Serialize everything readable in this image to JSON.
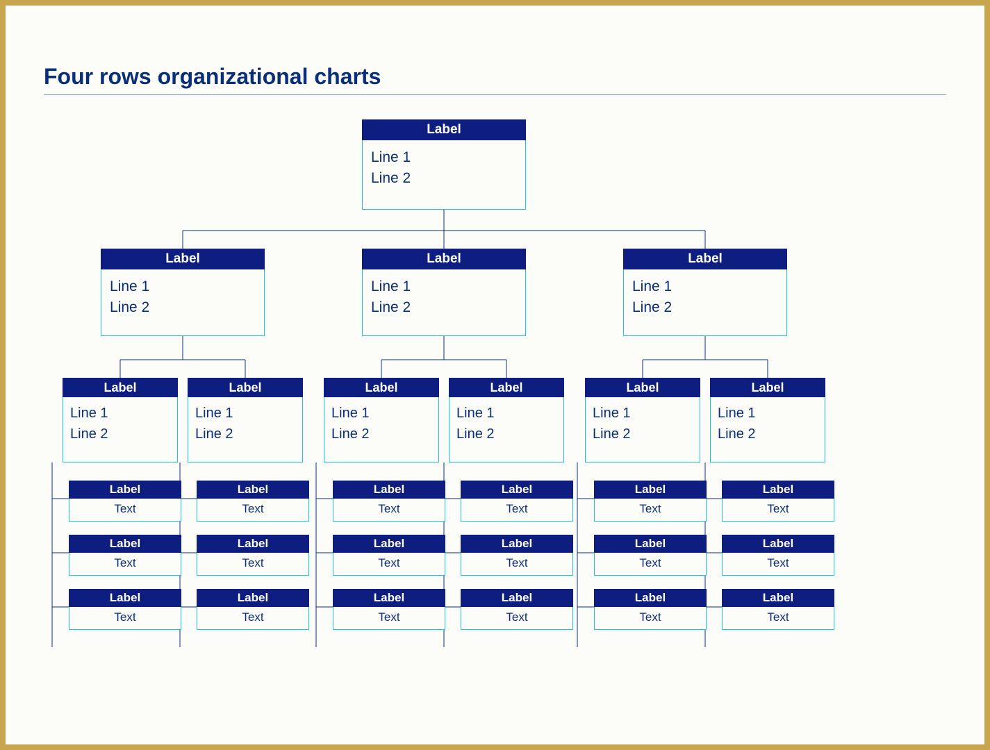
{
  "title": "Four rows organizational charts",
  "root": {
    "label": "Label",
    "line1": "Line 1",
    "line2": "Line 2"
  },
  "branches": [
    {
      "label": "Label",
      "line1": "Line 1",
      "line2": "Line 2",
      "children": [
        {
          "label": "Label",
          "line1": "Line 1",
          "line2": "Line 2",
          "leaves": [
            {
              "label": "Label",
              "text": "Text"
            },
            {
              "label": "Label",
              "text": "Text"
            },
            {
              "label": "Label",
              "text": "Text"
            }
          ]
        },
        {
          "label": "Label",
          "line1": "Line 1",
          "line2": "Line 2",
          "leaves": [
            {
              "label": "Label",
              "text": "Text"
            },
            {
              "label": "Label",
              "text": "Text"
            },
            {
              "label": "Label",
              "text": "Text"
            }
          ]
        }
      ]
    },
    {
      "label": "Label",
      "line1": "Line 1",
      "line2": "Line 2",
      "children": [
        {
          "label": "Label",
          "line1": "Line 1",
          "line2": "Line 2",
          "leaves": [
            {
              "label": "Label",
              "text": "Text"
            },
            {
              "label": "Label",
              "text": "Text"
            },
            {
              "label": "Label",
              "text": "Text"
            }
          ]
        },
        {
          "label": "Label",
          "line1": "Line 1",
          "line2": "Line 2",
          "leaves": [
            {
              "label": "Label",
              "text": "Text"
            },
            {
              "label": "Label",
              "text": "Text"
            },
            {
              "label": "Label",
              "text": "Text"
            }
          ]
        }
      ]
    },
    {
      "label": "Label",
      "line1": "Line 1",
      "line2": "Line 2",
      "children": [
        {
          "label": "Label",
          "line1": "Line 1",
          "line2": "Line 2",
          "leaves": [
            {
              "label": "Label",
              "text": "Text"
            },
            {
              "label": "Label",
              "text": "Text"
            },
            {
              "label": "Label",
              "text": "Text"
            }
          ]
        },
        {
          "label": "Label",
          "line1": "Line 1",
          "line2": "Line 2",
          "leaves": [
            {
              "label": "Label",
              "text": "Text"
            },
            {
              "label": "Label",
              "text": "Text"
            },
            {
              "label": "Label",
              "text": "Text"
            }
          ]
        }
      ]
    }
  ]
}
